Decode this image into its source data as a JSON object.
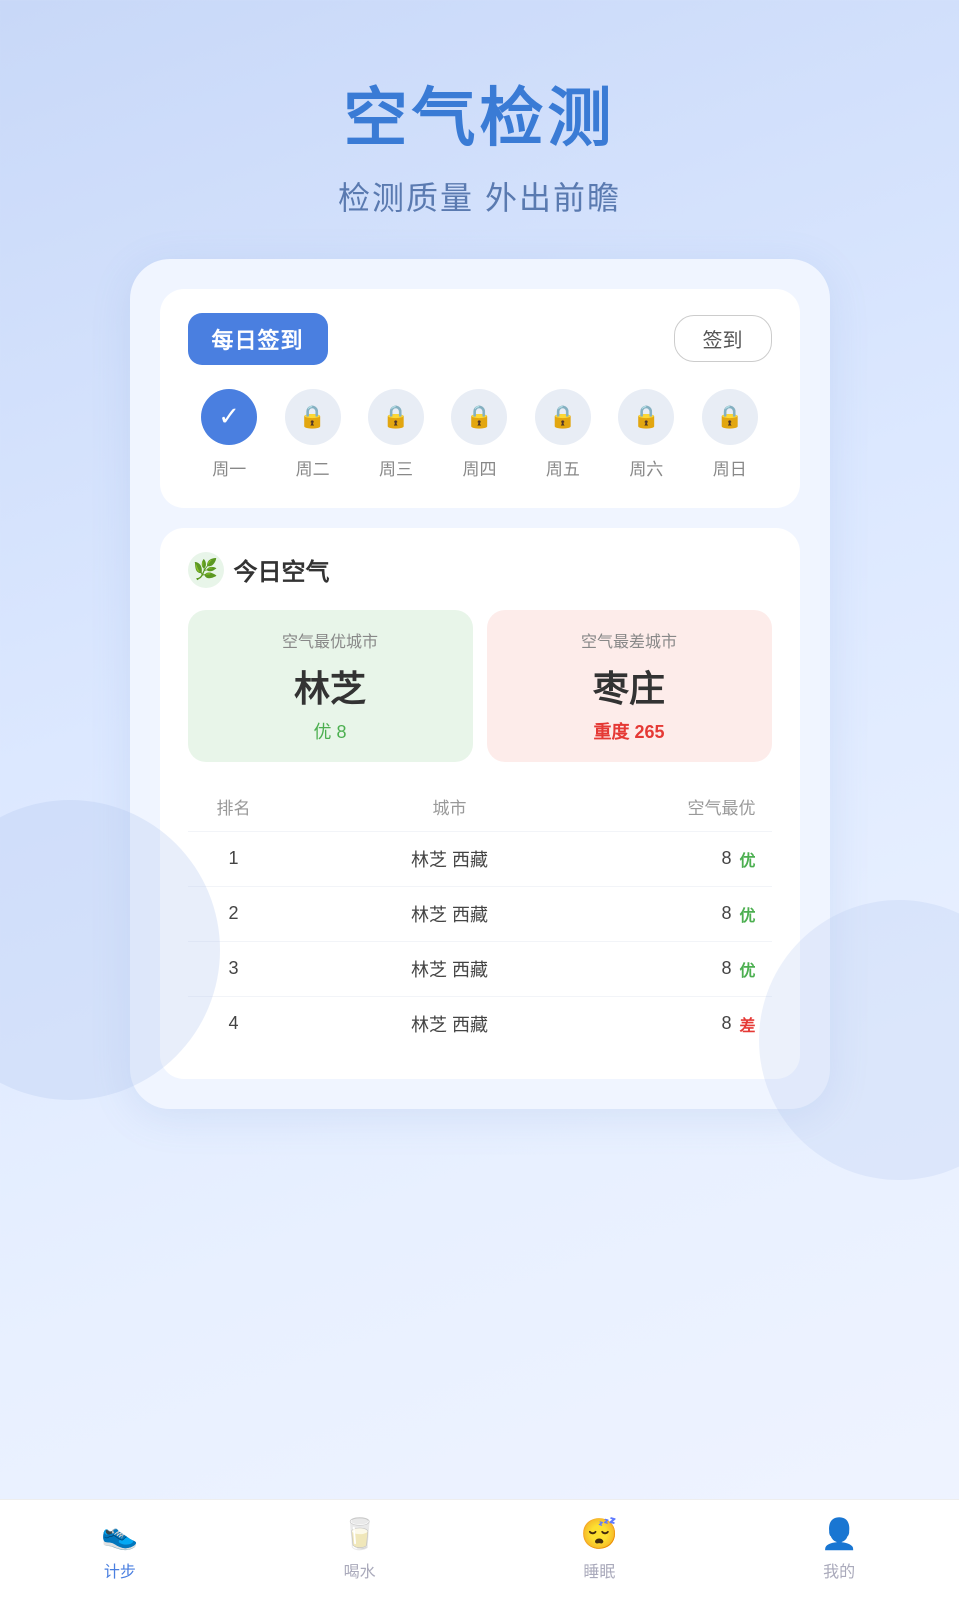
{
  "header": {
    "title": "空气检测",
    "subtitle": "检测质量 外出前瞻"
  },
  "checkin": {
    "section_title": "每日签到",
    "button_label": "签到",
    "days": [
      {
        "label": "周一",
        "state": "active"
      },
      {
        "label": "周二",
        "state": "locked"
      },
      {
        "label": "周三",
        "state": "locked"
      },
      {
        "label": "周四",
        "state": "locked"
      },
      {
        "label": "周五",
        "state": "locked"
      },
      {
        "label": "周六",
        "state": "locked"
      },
      {
        "label": "周日",
        "state": "locked"
      }
    ]
  },
  "air": {
    "section_title": "今日空气",
    "section_icon": "🌿",
    "best": {
      "label": "空气最优城市",
      "city": "林芝",
      "status": "优 8"
    },
    "worst": {
      "label": "空气最差城市",
      "city": "枣庄",
      "status": "重度 265"
    },
    "table_headers": {
      "rank": "排名",
      "city": "城市",
      "air": "空气最优"
    },
    "rows": [
      {
        "rank": "1",
        "city": "林芝 西藏",
        "value": "8",
        "tag": "优",
        "tag_type": "good"
      },
      {
        "rank": "2",
        "city": "林芝 西藏",
        "value": "8",
        "tag": "优",
        "tag_type": "good"
      },
      {
        "rank": "3",
        "city": "林芝 西藏",
        "value": "8",
        "tag": "优",
        "tag_type": "good"
      },
      {
        "rank": "4",
        "city": "林芝 西藏",
        "value": "8",
        "tag": "差",
        "tag_type": "bad"
      }
    ]
  },
  "bottom_nav": [
    {
      "label": "计步",
      "icon": "👟",
      "active": true
    },
    {
      "label": "喝水",
      "icon": "🥛",
      "active": false
    },
    {
      "label": "睡眠",
      "icon": "😴",
      "active": false
    },
    {
      "label": "我的",
      "icon": "👤",
      "active": false
    }
  ]
}
